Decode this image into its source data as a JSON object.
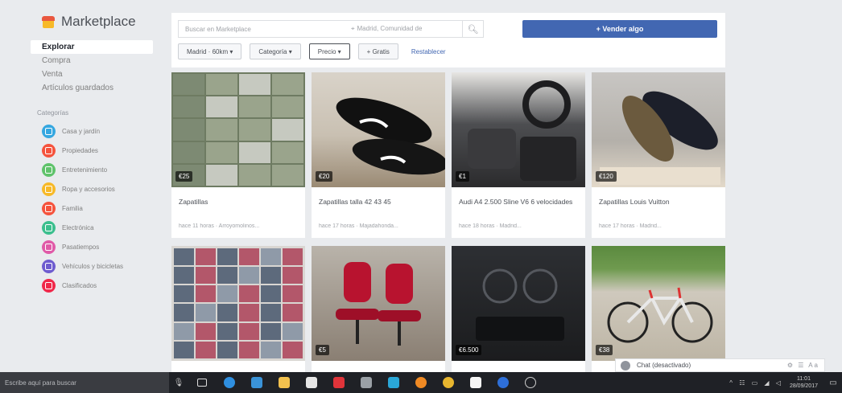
{
  "brand": {
    "title": "Marketplace",
    "accent": "#e9573f"
  },
  "nav": [
    {
      "label": "Explorar",
      "active": true
    },
    {
      "label": "Compra",
      "active": false
    },
    {
      "label": "Venta",
      "active": false
    },
    {
      "label": "Artículos guardados",
      "active": false
    }
  ],
  "categories_heading": "Categorías",
  "categories": [
    {
      "label": "Casa y jardín",
      "color": "#35a7e0"
    },
    {
      "label": "Propiedades",
      "color": "#f5533d"
    },
    {
      "label": "Entretenimiento",
      "color": "#5fc36b"
    },
    {
      "label": "Ropa y accesorios",
      "color": "#f7b928"
    },
    {
      "label": "Familia",
      "color": "#f5533d"
    },
    {
      "label": "Electrónica",
      "color": "#3bbf8e"
    },
    {
      "label": "Pasatiempos",
      "color": "#e05aa8"
    },
    {
      "label": "Vehículos y bicicletas",
      "color": "#6e5ccf"
    },
    {
      "label": "Clasificados",
      "color": "#f0284a"
    }
  ],
  "search": {
    "placeholder": "Buscar en Marketplace",
    "location": "Madrid, Comunidad de",
    "icon": "search-icon"
  },
  "sell_button": "+ Vender algo",
  "filters": [
    {
      "label": "Madrid · 60km ▾",
      "selected": false
    },
    {
      "label": "Categoría ▾",
      "selected": false
    },
    {
      "label": "Precio ▾",
      "selected": true
    },
    {
      "label": "+ Gratis",
      "selected": false
    }
  ],
  "reset_label": "Restablecer",
  "listings": [
    {
      "price": "€25",
      "title": "Zapatillas",
      "meta": "hace 11 horas · Arroyomolinos..."
    },
    {
      "price": "€20",
      "title": "Zapatillas talla 42 43 45",
      "meta": "hace 17 horas · Majadahonda..."
    },
    {
      "price": "€1",
      "title": "Audi A4 2.500 Sline V6 6 velocidades",
      "meta": "hace 18 horas · Madrid..."
    },
    {
      "price": "€120",
      "title": "Zapatillas Louis Vuitton",
      "meta": "hace 17 horas · Madrid..."
    },
    {
      "price": "",
      "title": "",
      "meta": ""
    },
    {
      "price": "€5",
      "title": "",
      "meta": ""
    },
    {
      "price": "€6.500",
      "title": "",
      "meta": ""
    },
    {
      "price": "€38",
      "title": "",
      "meta": ""
    }
  ],
  "chat": {
    "label": "Chat (desactivado)",
    "tools": "⚙ ☰ Aa"
  },
  "taskbar": {
    "search_text": "Escribe aquí para buscar",
    "time": "11:01",
    "date": "28/09/2017"
  }
}
